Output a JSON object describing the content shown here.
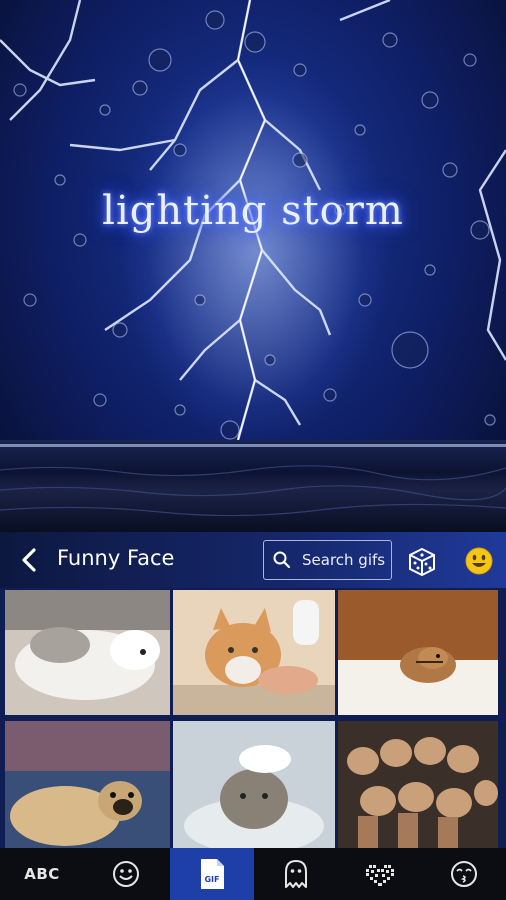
{
  "hero": {
    "title": "lighting  storm"
  },
  "toolbar": {
    "back_icon": "chevron-left-icon",
    "category_title": "Funny Face",
    "search_placeholder": "Search gifs",
    "search_icon": "search-icon",
    "random_icon": "dice-icon",
    "emoji_icon": "smiley-face-icon",
    "emoji_color": "#f5c518"
  },
  "gif_grid": {
    "items": [
      {
        "subject": "husky puppy"
      },
      {
        "subject": "cat being bathed"
      },
      {
        "subject": "chipmunk"
      },
      {
        "subject": "pug dog"
      },
      {
        "subject": "cat with shampoo"
      },
      {
        "subject": "group of kittens"
      }
    ]
  },
  "bottom_tabs": {
    "items": [
      {
        "label": "ABC",
        "icon": "abc-text"
      },
      {
        "icon": "smiley-outline-icon"
      },
      {
        "icon": "gif-file-icon",
        "badge": "GIF",
        "active": true
      },
      {
        "icon": "ghost-icon"
      },
      {
        "icon": "pixel-heart-icon"
      },
      {
        "icon": "kiss-face-icon"
      }
    ],
    "active_color": "#1e3fa8"
  }
}
